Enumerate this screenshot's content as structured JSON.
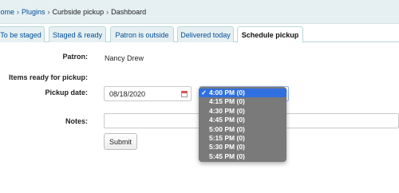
{
  "breadcrumb": {
    "home": "Home",
    "plugins": "Plugins",
    "plugin": "Curbside pickup",
    "current": "Dashboard",
    "separator": "›"
  },
  "tabs": [
    {
      "label": "To be staged"
    },
    {
      "label": "Staged & ready"
    },
    {
      "label": "Patron is outside"
    },
    {
      "label": "Delivered today"
    },
    {
      "label": "Schedule pickup"
    }
  ],
  "form": {
    "patron_label": "Patron:",
    "patron_value": "Nancy Drew",
    "items_label": "Items ready for pickup:",
    "pickup_date_label": "Pickup date:",
    "pickup_date_value": "08/18/2020",
    "notes_label": "Notes:",
    "notes_value": "",
    "submit_label": "Submit"
  },
  "time_select": {
    "selected": "4:00 PM (0)",
    "check": "✓",
    "options": [
      "4:00 PM (0)",
      "4:15 PM (0)",
      "4:30 PM (0)",
      "4:45 PM (0)",
      "5:00 PM (0)",
      "5:15 PM (0)",
      "5:30 PM (0)",
      "5:45 PM (0)"
    ]
  },
  "colors": {
    "link": "#004d99",
    "breadcrumb_bg": "#e6f0f2",
    "tab_border": "#b9d8d9",
    "dropdown_bg": "#7a7a7a",
    "selected_option": "#2f6fe0"
  }
}
